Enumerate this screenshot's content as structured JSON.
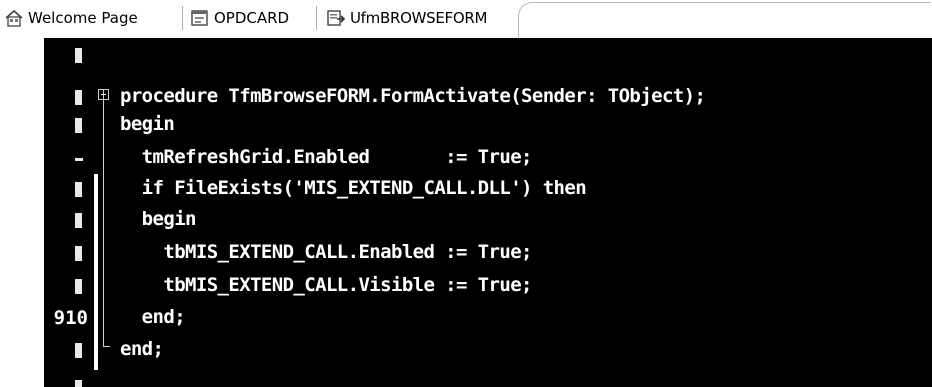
{
  "tabs": [
    {
      "label": "Welcome Page",
      "icon": "home-page-icon"
    },
    {
      "label": "OPDCARD",
      "icon": "form-icon"
    },
    {
      "label": "UfmBROWSEFORM",
      "icon": "unit-icon"
    }
  ],
  "editor": {
    "line_number_shown": "910",
    "lines": [
      "",
      "procedure TfmBrowseFORM.FormActivate(Sender: TObject);",
      "begin",
      "  tmRefreshGrid.Enabled       := True;",
      "  if FileExists('MIS_EXTEND_CALL.DLL') then",
      "  begin",
      "    tbMIS_EXTEND_CALL.Enabled := True;",
      "    tbMIS_EXTEND_CALL.Visible := True;",
      "  end;",
      "end;",
      ""
    ]
  },
  "colors": {
    "editor_background": "#000000",
    "code_text": "#ffffff",
    "tab_background": "#ffffff"
  }
}
